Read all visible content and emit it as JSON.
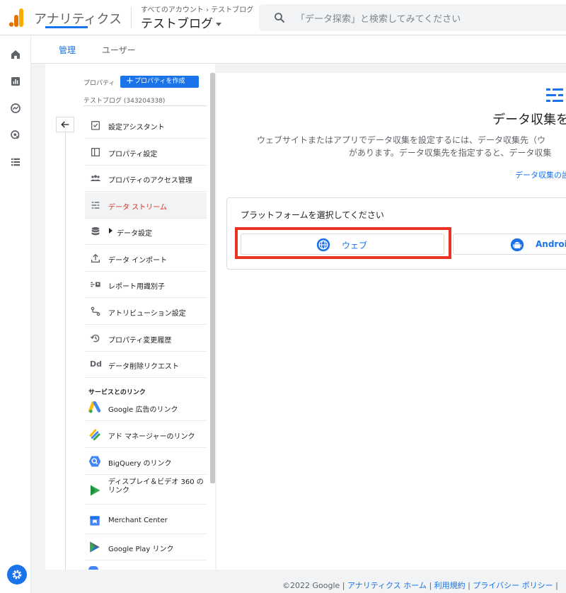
{
  "header": {
    "app_title": "アナリティクス",
    "breadcrumb": "すべてのアカウント › テストブログ",
    "property_name": "テストブログ",
    "search_placeholder": "「データ探索」と検索してみてください"
  },
  "rail": {
    "icons": [
      "home-icon",
      "reports-icon",
      "explore-icon",
      "advertising-icon",
      "configure-icon"
    ],
    "settings_icon": "gear-icon"
  },
  "admin_tabs": [
    {
      "label": "管理",
      "active": true
    },
    {
      "label": "ユーザー",
      "active": false
    }
  ],
  "property_panel": {
    "section_label": "プロパティ",
    "create_button": "プロパティを作成",
    "property_account": "テストブログ (343204338)",
    "back_icon": "arrow-left-icon",
    "items": [
      {
        "label": "設定アシスタント",
        "icon": "checklist-icon"
      },
      {
        "label": "プロパティ設定",
        "icon": "window-icon"
      },
      {
        "label": "プロパティのアクセス管理",
        "icon": "people-icon"
      },
      {
        "label": "データ ストリーム",
        "icon": "streams-icon",
        "active": true
      },
      {
        "label": "データ設定",
        "icon": "database-icon"
      },
      {
        "label": "データ インポート",
        "icon": "upload-icon"
      },
      {
        "label": "レポート用識別子",
        "icon": "identity-icon"
      },
      {
        "label": "アトリビューション設定",
        "icon": "attribution-icon"
      },
      {
        "label": "プロパティ変更履歴",
        "icon": "history-icon"
      },
      {
        "label": "データ削除リクエスト",
        "icon": "dd-icon"
      }
    ],
    "links_heading": "サービスとのリンク",
    "links": [
      {
        "label": "Google 広告のリンク",
        "icon": "google-ads-icon"
      },
      {
        "label": "アド マネージャーのリンク",
        "icon": "ad-manager-icon"
      },
      {
        "label": "BigQuery のリンク",
        "icon": "bigquery-icon"
      },
      {
        "label": "ディスプレイ＆ビデオ 360 のリンク",
        "icon": "dv360-icon"
      },
      {
        "label": "Merchant Center",
        "icon": "merchant-center-icon"
      },
      {
        "label": "Google Play リンク",
        "icon": "google-play-icon"
      }
    ]
  },
  "main": {
    "title": "データ収集を",
    "desc_line1": "ウェブサイトまたはアプリでデータ収集を設定するには、データ収集先（ウ",
    "desc_line2": "があります。データ収集先を指定すると、データ収集",
    "link": "データ収集の設",
    "platform_heading": "プラットフォームを選択してください",
    "platforms": [
      {
        "label": "ウェブ",
        "icon": "globe-icon"
      },
      {
        "label": "Android",
        "icon": "android-icon"
      }
    ]
  },
  "footer": {
    "copyright": "©2022 Google",
    "links": [
      "アナリティクス ホーム",
      "利用規約",
      "プライバシー ポリシー"
    ]
  },
  "colors": {
    "accent": "#1a73e8",
    "active_nav": "#d93025",
    "highlight_frame": "#ea3323"
  }
}
